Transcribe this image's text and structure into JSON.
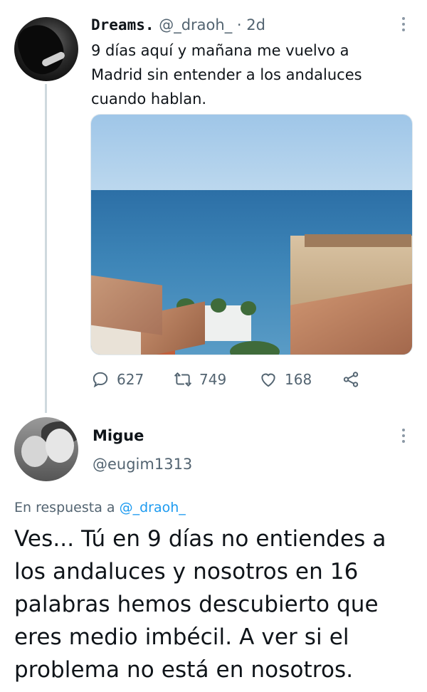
{
  "original_tweet": {
    "display_name": "Dreams.",
    "handle": "@_draoh_",
    "separator": "·",
    "time": "2d",
    "text": "9 días aquí y mañana me vuelvo a Madrid sin entender a los andaluces cuando hablan.",
    "stats": {
      "replies": "627",
      "retweets": "749",
      "likes": "168"
    }
  },
  "reply": {
    "display_name": "Migue",
    "handle": "@eugim1313",
    "replying_prefix": "En respuesta a",
    "replying_to": "@_draoh_",
    "text": "Ves... Tú en 9 días no entiendes a los andaluces y nosotros en 16 palabras hemos descubierto que eres medio imbécil. A  ver si el problema no está en nosotros."
  },
  "colors": {
    "text_primary": "#0f1419",
    "text_secondary": "#536471",
    "link": "#1d9bf0",
    "thread_line": "#cfd9de"
  }
}
